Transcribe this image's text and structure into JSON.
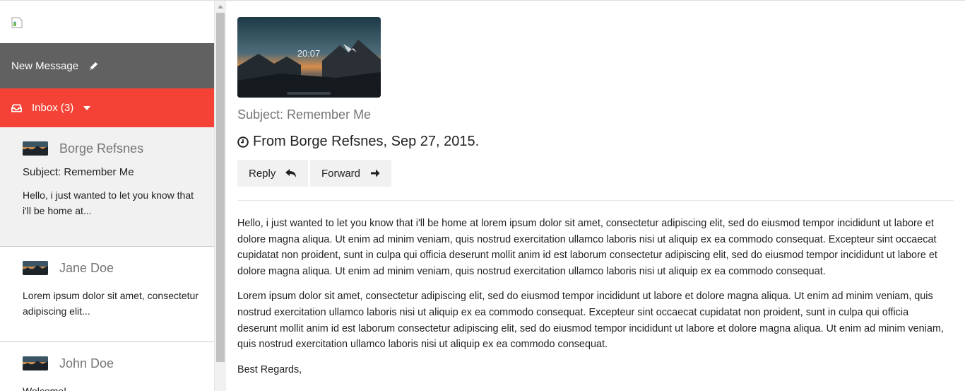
{
  "sidebar": {
    "logo_alt": "",
    "new_message_label": "New Message",
    "inbox_label": "Inbox (3)",
    "messages": [
      {
        "sender": "Borge Refsnes",
        "subject": "Subject: Remember Me",
        "preview": "Hello, i just wanted to let you know that i'll be home at..."
      },
      {
        "sender": "Jane Doe",
        "preview": "Lorem ipsum dolor sit amet, consectetur adipiscing elit..."
      },
      {
        "sender": "John Doe",
        "preview": "Welcome!"
      }
    ]
  },
  "main": {
    "hero_clock": "20:07",
    "subject": "Subject: Remember Me",
    "from_line": "From Borge Refsnes, Sep 27, 2015.",
    "reply_label": "Reply",
    "forward_label": "Forward",
    "body": [
      "Hello, i just wanted to let you know that i'll be home at lorem ipsum dolor sit amet, consectetur adipiscing elit, sed do eiusmod tempor incididunt ut labore et dolore magna aliqua. Ut enim ad minim veniam, quis nostrud exercitation ullamco laboris nisi ut aliquip ex ea commodo consequat. Excepteur sint occaecat cupidatat non proident, sunt in culpa qui officia deserunt mollit anim id est laborum consectetur adipiscing elit, sed do eiusmod tempor incididunt ut labore et dolore magna aliqua. Ut enim ad minim veniam, quis nostrud exercitation ullamco laboris nisi ut aliquip ex ea commodo consequat.",
      "Lorem ipsum dolor sit amet, consectetur adipiscing elit, sed do eiusmod tempor incididunt ut labore et dolore magna aliqua. Ut enim ad minim veniam, quis nostrud exercitation ullamco laboris nisi ut aliquip ex ea commodo consequat. Excepteur sint occaecat cupidatat non proident, sunt in culpa qui officia deserunt mollit anim id est laborum consectetur adipiscing elit, sed do eiusmod tempor incididunt ut labore et dolore magna aliqua. Ut enim ad minim veniam, quis nostrud exercitation ullamco laboris nisi ut aliquip ex ea commodo consequat.",
      "Best Regards,"
    ]
  },
  "icons": {
    "logo": "broken-image-icon",
    "new_message": "pencil-icon",
    "inbox": "inbox-tray-icon",
    "inbox_toggle": "caret-down-icon",
    "from": "clock-icon",
    "reply": "reply-arrow-icon",
    "forward": "arrow-right-icon"
  },
  "colors": {
    "new_message_bg": "#616161",
    "inbox_bg": "#f44336",
    "active_item_bg": "#f1f1f1",
    "button_bg": "#f1f1f1",
    "muted_text": "#757575"
  }
}
